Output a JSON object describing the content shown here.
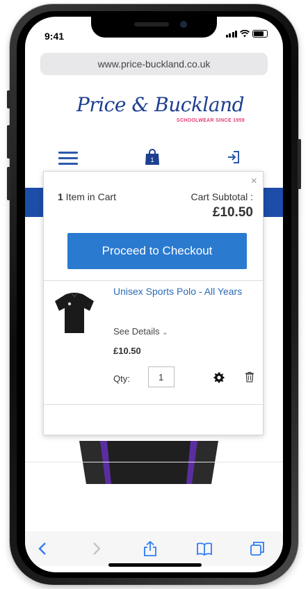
{
  "status": {
    "time": "9:41"
  },
  "browser": {
    "url": "www.price-buckland.co.uk"
  },
  "brand": {
    "name": "Price & Buckland",
    "tagline": "SCHOOLWEAR SINCE 1959",
    "primary_color": "#1d3f8f",
    "accent_color": "#e4397a"
  },
  "header": {
    "icons": [
      "menu-icon",
      "shopping-bag-icon",
      "sign-in-icon"
    ],
    "cart_count": "1"
  },
  "minicart": {
    "close_label": "×",
    "item_count_number": "1",
    "item_count_text": " Item in Cart",
    "subtotal_label": "Cart Subtotal :",
    "subtotal_value": "£10.50",
    "checkout_label": "Proceed to Checkout",
    "checkout_color": "#2a7ad0",
    "items": [
      {
        "name": "Unisex Sports Polo - All Years",
        "details_label": "See Details",
        "price": "£10.50",
        "qty_label": "Qty:",
        "qty": "1"
      }
    ]
  },
  "safari_toolbar": {
    "icons": [
      "back-icon",
      "forward-icon",
      "share-icon",
      "bookmarks-icon",
      "tabs-icon"
    ]
  }
}
